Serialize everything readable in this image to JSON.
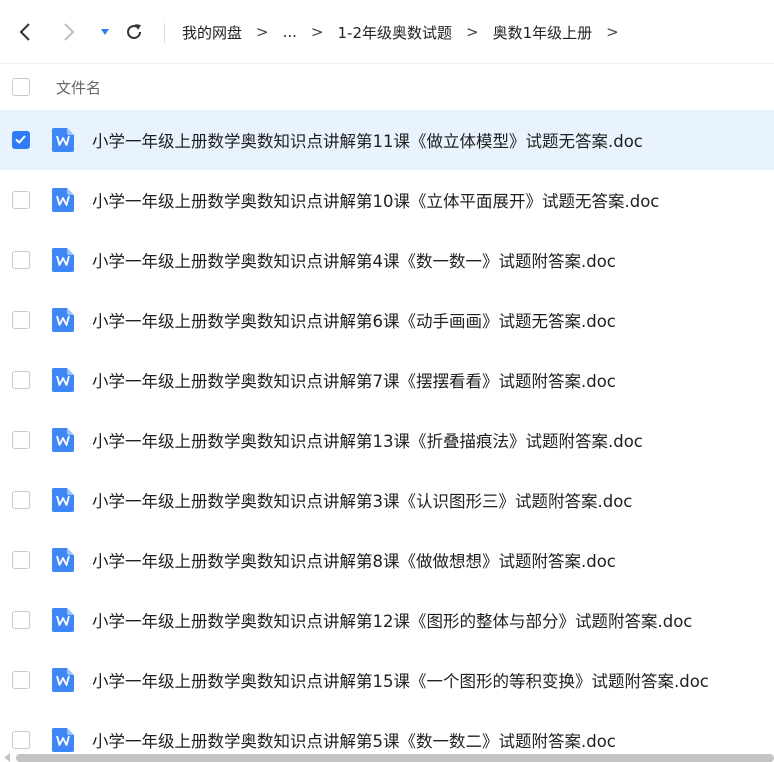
{
  "toolbar": {
    "back_icon": "chevron-left-icon",
    "forward_icon": "chevron-right-icon",
    "dropdown_icon": "caret-down-icon",
    "refresh_icon": "refresh-icon",
    "accent_color": "#2f7cf6"
  },
  "breadcrumb": {
    "items": [
      "我的网盘",
      "...",
      "1-2年级奥数试题",
      "奥数1年级上册"
    ],
    "separator": ">"
  },
  "list_header": {
    "name_label": "文件名"
  },
  "files": [
    {
      "name": "小学一年级上册数学奥数知识点讲解第11课《做立体模型》试题无答案.doc",
      "selected": true
    },
    {
      "name": "小学一年级上册数学奥数知识点讲解第10课《立体平面展开》试题无答案.doc",
      "selected": false
    },
    {
      "name": "小学一年级上册数学奥数知识点讲解第4课《数一数一》试题附答案.doc",
      "selected": false
    },
    {
      "name": "小学一年级上册数学奥数知识点讲解第6课《动手画画》试题无答案.doc",
      "selected": false
    },
    {
      "name": "小学一年级上册数学奥数知识点讲解第7课《摆摆看看》试题附答案.doc",
      "selected": false
    },
    {
      "name": "小学一年级上册数学奥数知识点讲解第13课《折叠描痕法》试题附答案.doc",
      "selected": false
    },
    {
      "name": "小学一年级上册数学奥数知识点讲解第3课《认识图形三》试题附答案.doc",
      "selected": false
    },
    {
      "name": "小学一年级上册数学奥数知识点讲解第8课《做做想想》试题附答案.doc",
      "selected": false
    },
    {
      "name": "小学一年级上册数学奥数知识点讲解第12课《图形的整体与部分》试题附答案.doc",
      "selected": false
    },
    {
      "name": "小学一年级上册数学奥数知识点讲解第15课《一个图形的等积变换》试题附答案.doc",
      "selected": false
    },
    {
      "name": "小学一年级上册数学奥数知识点讲解第5课《数一数二》试题附答案.doc",
      "selected": false
    }
  ],
  "file_icon": "word-doc-icon",
  "file_icon_color": "#3f86f6"
}
